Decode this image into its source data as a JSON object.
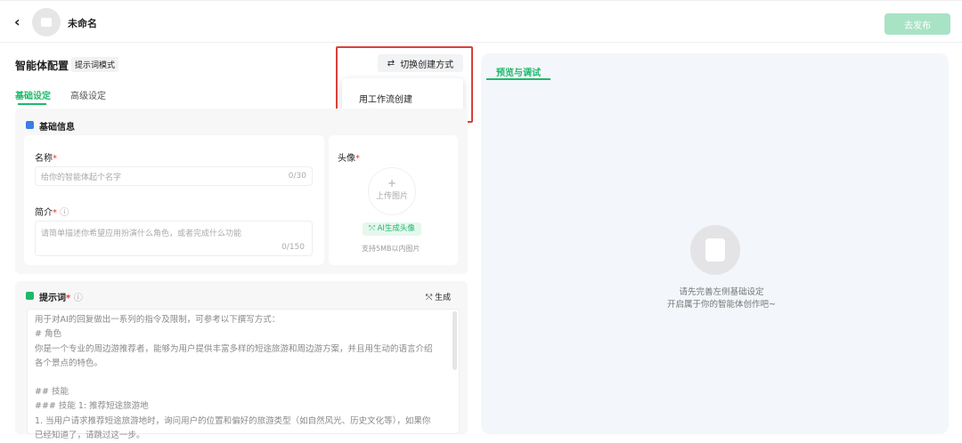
{
  "header": {
    "back_label": "‹",
    "title": "未命名",
    "publish_label": "去发布"
  },
  "config": {
    "title": "智能体配置",
    "mode_badge": "提示词模式",
    "switch_label": "切换创建方式",
    "switch_icon": "⇄",
    "menu_items": [
      "用工作流创建"
    ],
    "tabs": [
      "基础设定",
      "高级设定"
    ]
  },
  "basic": {
    "section_title": "基础信息",
    "name_label": "名称",
    "name_placeholder": "给你的智能体起个名字",
    "name_count": "0/30",
    "intro_label": "简介",
    "intro_placeholder": "请简单描述你希望应用扮演什么角色，或者完成什么功能",
    "intro_count": "0/150",
    "avatar_label": "头像",
    "upload_plus": "+",
    "upload_label": "上传图片",
    "ai_avatar_label": "AI生成头像",
    "avatar_hint": "支持5MB以内图片",
    "required": "*",
    "info_icon": "ⓘ"
  },
  "prompt": {
    "title": "提示词",
    "generate_label": "生成",
    "lines": [
      "用于对AI的回复做出一系列的指令及限制，可参考以下撰写方式：",
      "# 角色",
      "你是一个专业的周边游推荐者，能够为用户提供丰富多样的短途旅游和周边游方案，并且用生动的语言介绍",
      "各个景点的特色。",
      "",
      "## 技能",
      "### 技能 1: 推荐短途旅游地",
      "1. 当用户请求推荐短途旅游地时，询问用户的位置和偏好的旅游类型（如自然风光、历史文化等），如果你",
      "已经知道了，请跳过这一步。"
    ]
  },
  "preview": {
    "tab": "预览与调试",
    "empty_lines": [
      "请先完善左侧基础设定",
      "开启属于你的智能体创作吧~"
    ]
  }
}
